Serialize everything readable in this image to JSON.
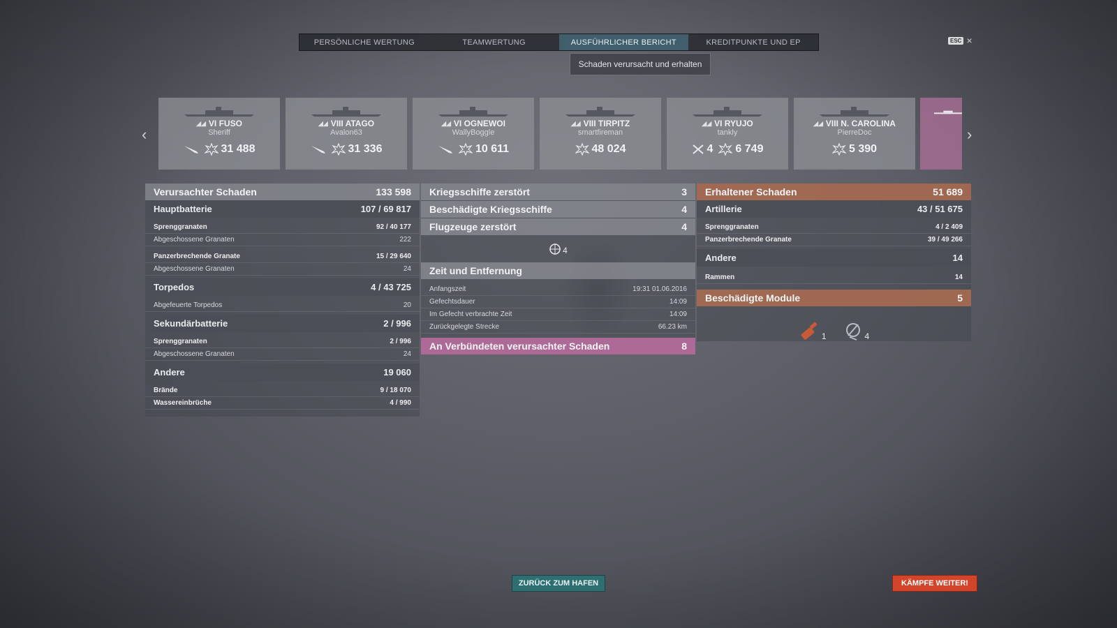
{
  "tabs": [
    {
      "label": "PERSÖNLICHE WERTUNG"
    },
    {
      "label": "TEAMWERTUNG"
    },
    {
      "label": "AUSFÜHRLICHER BERICHT"
    },
    {
      "label": "KREDITPUNKTE UND EP"
    }
  ],
  "active_tab": "AUSFÜHRLICHER BERICHT",
  "subtab": "Schaden verursacht und erhalten",
  "esc": {
    "key": "ESC",
    "close": "×"
  },
  "ships": [
    {
      "name": "VI FUSO",
      "player": "Sheriff",
      "badge": "",
      "damage": "31 488",
      "icons": [
        "torpedo-hit-icon",
        "ribbon-icon"
      ]
    },
    {
      "name": "VIII ATAGO",
      "player": "Avalon63",
      "badge": "",
      "damage": "31 336",
      "icons": [
        "torpedo-hit-icon",
        "ribbon-icon"
      ]
    },
    {
      "name": "VI OGNEWOI",
      "player": "WallyBoggle",
      "badge": "",
      "damage": "10 611",
      "icons": [
        "torpedo-hit-icon",
        "ribbon-icon"
      ]
    },
    {
      "name": "VIII TIRPITZ",
      "player": "smartfireman",
      "badge": "",
      "damage": "48 024",
      "icons": [
        "ribbon-icon"
      ]
    },
    {
      "name": "VI RYUJO",
      "player": "tankly",
      "badge": "4",
      "damage": "6 749",
      "icons": [
        "planes-destroyed-icon",
        "ribbon-icon"
      ]
    },
    {
      "name": "VIII N. CAROLINA",
      "player": "PierreDoc",
      "badge": "",
      "damage": "5 390",
      "icons": [
        "ribbon-icon"
      ]
    }
  ],
  "left": {
    "header": {
      "label": "Verursachter Schaden",
      "value": "133 598"
    },
    "sections": [
      {
        "label": "Hauptbatterie",
        "value": "107 / 69 817",
        "details": [
          {
            "label": "Sprenggranaten",
            "value": "92 / 40 177",
            "bold": true
          },
          {
            "label": "Abgeschossene Granaten",
            "value": "222",
            "bold": false
          },
          {
            "label": "Panzerbrechende Granate",
            "value": "15 / 29 640",
            "bold": true
          },
          {
            "label": "Abgeschossene Granaten",
            "value": "24",
            "bold": false
          }
        ]
      },
      {
        "label": "Torpedos",
        "value": "4 / 43 725",
        "details": [
          {
            "label": "Abgefeuerte Torpedos",
            "value": "20",
            "bold": false
          }
        ]
      },
      {
        "label": "Sekundärbatterie",
        "value": "2 / 996",
        "details": [
          {
            "label": "Sprenggranaten",
            "value": "2 / 996",
            "bold": true
          },
          {
            "label": "Abgeschossene Granaten",
            "value": "24",
            "bold": false
          }
        ]
      },
      {
        "label": "Andere",
        "value": "19 060",
        "details": [
          {
            "label": "Brände",
            "value": "9 / 18 070",
            "bold": true
          },
          {
            "label": "Wassereinbrüche",
            "value": "4 / 990",
            "bold": true
          }
        ]
      }
    ]
  },
  "middle": {
    "rows": [
      {
        "label": "Kriegsschiffe zerstört",
        "value": "3"
      },
      {
        "label": "Beschädigte Kriegsschiffe",
        "value": "4"
      },
      {
        "label": "Flugzeuge zerstört",
        "value": "4"
      }
    ],
    "aircraft_icon_count": "4",
    "time_header": "Zeit und Entfernung",
    "time_rows": [
      {
        "label": "Anfangszeit",
        "value": "19:31  01.06.2016"
      },
      {
        "label": "Gefechtsdauer",
        "value": "14:09"
      },
      {
        "label": "Im Gefecht verbrachte Zeit",
        "value": "14:09"
      },
      {
        "label": "Zurückgelegte Strecke",
        "value": "66.23 km"
      }
    ],
    "allies": {
      "label": "An Verbündeten verursachter Schaden",
      "value": "8"
    }
  },
  "right": {
    "header": {
      "label": "Erhaltener Schaden",
      "value": "51 689"
    },
    "artillerie": {
      "label": "Artillerie",
      "value": "43 / 51 675",
      "details": [
        {
          "label": "Sprenggranaten",
          "value": "4 / 2 409"
        },
        {
          "label": "Panzerbrechende Granate",
          "value": "39 / 49 266"
        }
      ]
    },
    "andere": {
      "label": "Andere",
      "value": "14",
      "details": [
        {
          "label": "Rammen",
          "value": "14"
        }
      ]
    },
    "modules": {
      "label": "Beschädigte Module",
      "value": "5",
      "icons": [
        {
          "name": "gun-module-icon",
          "count": "1"
        },
        {
          "name": "aa-module-icon",
          "count": "4"
        }
      ]
    }
  },
  "buttons": {
    "back": "ZURÜCK ZUM HAFEN",
    "continue": "KÄMPFE WEITER!"
  },
  "colors": {
    "accent_teal": "#2e6f72",
    "accent_orange": "#d2452a",
    "received_header": "#b46e50",
    "allies_header": "#be6ea0"
  }
}
